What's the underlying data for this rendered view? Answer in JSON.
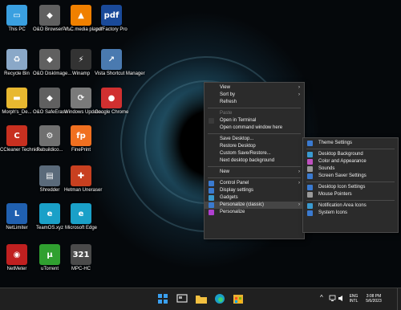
{
  "desktop_icons": [
    {
      "label": "This PC",
      "icon": "this-pc-icon",
      "color": "#3aa0e0",
      "glyph": "▭"
    },
    {
      "label": "O&O BrowserPriv...",
      "icon": "oo-browser-icon",
      "color": "#606060",
      "glyph": "◆"
    },
    {
      "label": "VLC media player",
      "icon": "vlc-icon",
      "color": "#f08000",
      "glyph": "▲"
    },
    {
      "label": "pdfFactory Pro",
      "icon": "pdffactory-icon",
      "color": "#1a4a9a",
      "glyph": "pdf"
    },
    {
      "label": "Recycle Bin",
      "icon": "recycle-bin-icon",
      "color": "#8aa8c8",
      "glyph": "♻"
    },
    {
      "label": "O&O DiskImage...",
      "icon": "oo-diskimage-icon",
      "color": "#606060",
      "glyph": "◆"
    },
    {
      "label": "Winamp",
      "icon": "winamp-icon",
      "color": "#333333",
      "glyph": "⚡"
    },
    {
      "label": "Vista Shortcut Manager",
      "icon": "vista-shortcut-icon",
      "color": "#4a7ab0",
      "glyph": "↗"
    },
    {
      "label": "Morph's_De...",
      "icon": "folder-icon",
      "color": "#e8b830",
      "glyph": "▬"
    },
    {
      "label": "O&O SafeErase",
      "icon": "oo-safeerase-icon",
      "color": "#606060",
      "glyph": "◆"
    },
    {
      "label": "Windows Update...",
      "icon": "windows-update-icon",
      "color": "#7a7a7a",
      "glyph": "⟳"
    },
    {
      "label": "Google Chrome",
      "icon": "chrome-icon",
      "color": "#d03030",
      "glyph": "●"
    },
    {
      "label": "CCleaner Technici...",
      "icon": "ccleaner-icon",
      "color": "#c83020",
      "glyph": "C"
    },
    {
      "label": "Rebuildico...",
      "icon": "rebuildicons-icon",
      "color": "#707070",
      "glyph": "⚙"
    },
    {
      "label": "FinePrint",
      "icon": "fineprint-icon",
      "color": "#f07020",
      "glyph": "fp"
    },
    {
      "label": "Shredder",
      "icon": "shredder-icon",
      "color": "#5a6a7a",
      "glyph": "▤"
    },
    {
      "label": "Hetman Uneraser",
      "icon": "hetman-icon",
      "color": "#c84020",
      "glyph": "✚"
    },
    {
      "label": "NetLimiter",
      "icon": "netlimiter-icon",
      "color": "#2060b0",
      "glyph": "L"
    },
    {
      "label": "TeamOS.xyz",
      "icon": "edge-icon",
      "color": "#1aa0c8",
      "glyph": "e"
    },
    {
      "label": "Microsoft Edge",
      "icon": "edge-icon",
      "color": "#1aa0c8",
      "glyph": "e"
    },
    {
      "label": "NetMeter",
      "icon": "netmeter-icon",
      "color": "#c02020",
      "glyph": "◉"
    },
    {
      "label": "uTorrent",
      "icon": "utorrent-icon",
      "color": "#30a030",
      "glyph": "µ"
    },
    {
      "label": "MPC-HC",
      "icon": "mpc-hc-icon",
      "color": "#4a4a4a",
      "glyph": "321"
    }
  ],
  "context_menu": {
    "items": [
      {
        "label": "View",
        "arrow": "›",
        "name": "menu-item-view"
      },
      {
        "label": "Sort by",
        "arrow": "›",
        "name": "menu-item-sort-by"
      },
      {
        "label": "Refresh",
        "name": "menu-item-refresh"
      },
      {
        "label": "Paste",
        "disabled": true,
        "name": "menu-item-paste"
      },
      {
        "label": "Open in Terminal",
        "name": "menu-item-open-terminal",
        "icon": "terminal-icon"
      },
      {
        "label": "Open command window here",
        "name": "menu-item-open-command"
      },
      {
        "label": "Save Desktop...",
        "name": "menu-item-save-desktop"
      },
      {
        "label": "Restore Desktop",
        "name": "menu-item-restore-desktop"
      },
      {
        "label": "Custom Save/Restore...",
        "name": "menu-item-custom-save"
      },
      {
        "label": "Next desktop background",
        "name": "menu-item-next-background"
      },
      {
        "label": "New",
        "arrow": "›",
        "name": "menu-item-new"
      },
      {
        "label": "Control Panel",
        "arrow": "›",
        "name": "menu-item-control-panel",
        "icon": "control-panel-icon"
      },
      {
        "label": "Display settings",
        "name": "menu-item-display-settings",
        "icon": "display-icon"
      },
      {
        "label": "Gadgets",
        "name": "menu-item-gadgets",
        "icon": "gadgets-icon"
      },
      {
        "label": "Personalize (classic)",
        "arrow": "›",
        "name": "menu-item-personalize-classic",
        "icon": "personalize-classic-icon"
      },
      {
        "label": "Personalize",
        "name": "menu-item-personalize",
        "icon": "brush-icon"
      }
    ]
  },
  "submenu": {
    "items": [
      {
        "label": "Theme Settings",
        "name": "submenu-item-theme-settings",
        "icon": "theme-icon"
      },
      {
        "label": "Desktop Background",
        "name": "submenu-item-desktop-background",
        "icon": "background-icon"
      },
      {
        "label": "Color and Appearance",
        "name": "submenu-item-color-appearance",
        "icon": "color-icon"
      },
      {
        "label": "Sounds",
        "name": "submenu-item-sounds",
        "icon": "sound-icon"
      },
      {
        "label": "Screen Saver Settings",
        "name": "submenu-item-screen-saver",
        "icon": "screensaver-icon"
      },
      {
        "label": "Desktop Icon Settings",
        "name": "submenu-item-desktop-icons",
        "icon": "desktop-icon"
      },
      {
        "label": "Mouse Pointers",
        "name": "submenu-item-mouse-pointers",
        "icon": "mouse-icon"
      },
      {
        "label": "Notification Area Icons",
        "name": "submenu-item-notification-icons",
        "icon": "notification-icon"
      },
      {
        "label": "System Icons",
        "name": "submenu-item-system-icons",
        "icon": "system-icons-icon"
      }
    ]
  },
  "taskbar": {
    "apps": [
      "start-icon",
      "search-icon",
      "task-view-icon",
      "file-explorer-icon",
      "edge-icon",
      "store-icon"
    ],
    "tray": {
      "chevron": "^",
      "language_top": "ENG",
      "language_bottom": "INTL",
      "time": "3:08 PM",
      "date": "5/6/2023"
    }
  },
  "colors": {
    "menu_bg": "#2b2b2b",
    "menu_highlight": "#454545",
    "taskbar_bg": "#202020",
    "accent": "#0078d4"
  }
}
